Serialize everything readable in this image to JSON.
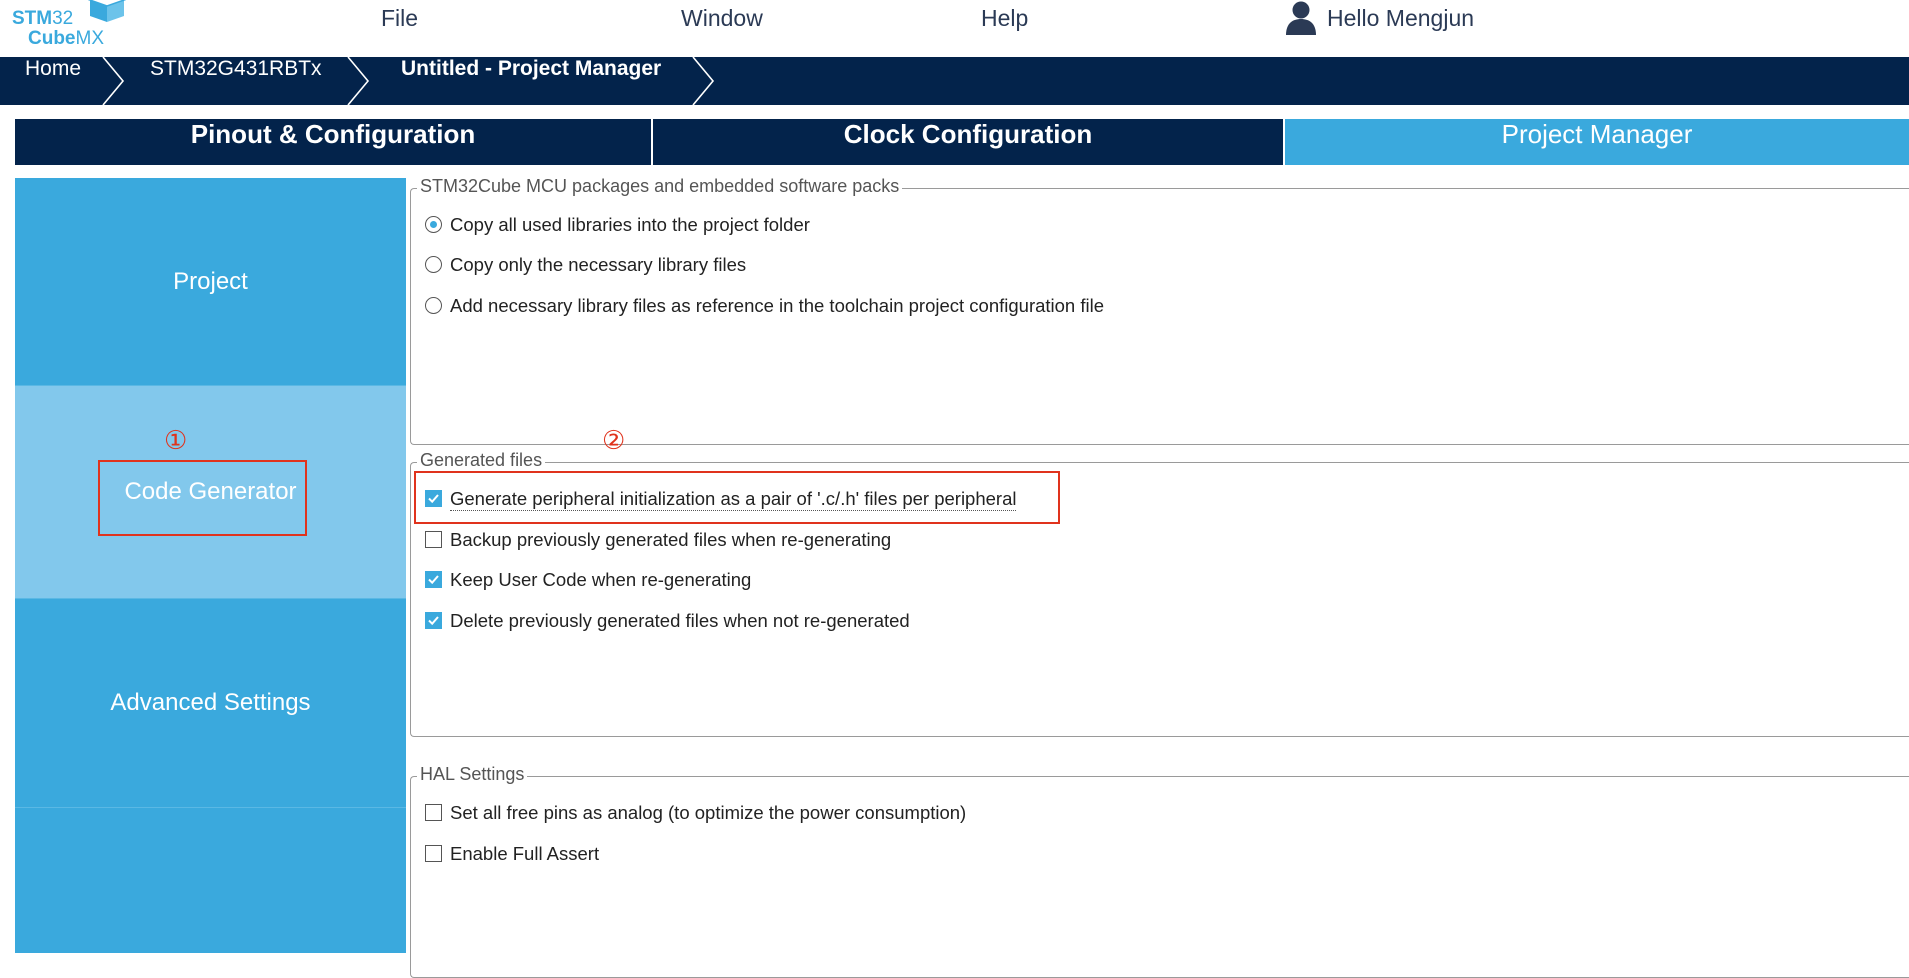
{
  "logo": {
    "line1_bold": "STM",
    "line1_rest": "32",
    "line2_bold": "Cube",
    "line2_rest": "MX"
  },
  "menu": {
    "file": "File",
    "window": "Window",
    "help": "Help"
  },
  "user": {
    "greeting": "Hello Mengjun",
    "icon": "user-icon"
  },
  "breadcrumb": [
    "Home",
    "STM32G431RBTx",
    "Untitled - Project Manager"
  ],
  "tabs": [
    "Pinout & Configuration",
    "Clock Configuration",
    "Project Manager"
  ],
  "active_tab": "Project Manager",
  "sidenav": {
    "items": [
      "Project",
      "Code Generator",
      "Advanced Settings"
    ],
    "selected": "Code Generator"
  },
  "groups": {
    "packages": {
      "title": "STM32Cube MCU packages and embedded software packs",
      "options": [
        {
          "label": "Copy all used libraries into the project folder",
          "checked": true
        },
        {
          "label": "Copy only the necessary library files",
          "checked": false
        },
        {
          "label": "Add necessary library files as reference in the toolchain project configuration file",
          "checked": false
        }
      ]
    },
    "generated": {
      "title": "Generated files",
      "options": [
        {
          "label": "Generate peripheral initialization as a pair of '.c/.h' files per peripheral",
          "checked": true
        },
        {
          "label": "Backup previously generated files when re-generating",
          "checked": false
        },
        {
          "label": "Keep User Code when re-generating",
          "checked": true
        },
        {
          "label": "Delete previously generated files when not re-generated",
          "checked": true
        }
      ]
    },
    "hal": {
      "title": "HAL Settings",
      "options": [
        {
          "label": "Set all free pins as analog (to optimize the power consumption)",
          "checked": false
        },
        {
          "label": "Enable Full Assert",
          "checked": false
        }
      ]
    }
  },
  "annotations": {
    "marker1": "①",
    "marker2": "②"
  },
  "colors": {
    "navy": "#03234b",
    "accent": "#3aa9dd",
    "selected_nav": "#82c8ec",
    "annotation": "#e0331d"
  }
}
